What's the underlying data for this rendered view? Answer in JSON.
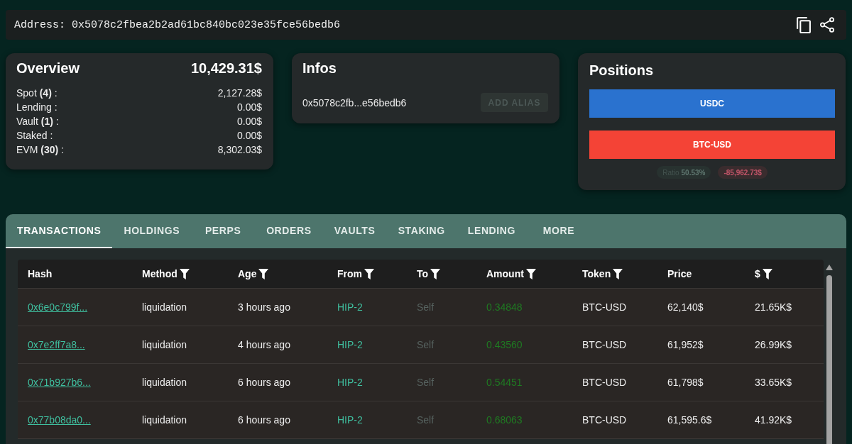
{
  "address_bar": {
    "label": "Address:",
    "value": "0x5078c2fbea2b2ad61bc840bc023e35fce56bedb6"
  },
  "overview": {
    "title": "Overview",
    "total": "10,429.31$",
    "rows": [
      {
        "label": "Spot **(4)** :",
        "value": "2,127.28$"
      },
      {
        "label": "Lending :",
        "value": "0.00$"
      },
      {
        "label": "Vault **(1)** :",
        "value": "0.00$"
      },
      {
        "label": "Staked :",
        "value": "0.00$"
      },
      {
        "label": "EVM **(30)** :",
        "value": "8,302.03$"
      }
    ]
  },
  "infos": {
    "title": "Infos",
    "address": "0x5078c2fb...e56bedb6",
    "alias_button": {
      "label": "ADD ALIAS",
      "disabled": true
    }
  },
  "positions": {
    "title": "Positions",
    "bars": [
      {
        "label": "USDC",
        "color": "#2a72cf"
      },
      {
        "label": "BTC-USD",
        "color": "#f44336"
      }
    ],
    "ratio": {
      "label": "Ratio",
      "value": "50.53%"
    },
    "pnl": "-85,962.73$"
  },
  "tabs": [
    {
      "label": "TRANSACTIONS",
      "selected": true
    },
    {
      "label": "HOLDINGS",
      "selected": false
    },
    {
      "label": "PERPS",
      "selected": false
    },
    {
      "label": "ORDERS",
      "selected": false
    },
    {
      "label": "VAULTS",
      "selected": false
    },
    {
      "label": "STAKING",
      "selected": false
    },
    {
      "label": "LENDING",
      "selected": false
    },
    {
      "label": "MORE",
      "selected": false
    }
  ],
  "table": {
    "columns": [
      {
        "label": "Hash",
        "filter": false
      },
      {
        "label": "Method",
        "filter": true
      },
      {
        "label": "Age",
        "filter": true
      },
      {
        "label": "From",
        "filter": true
      },
      {
        "label": "To",
        "filter": true
      },
      {
        "label": "Amount",
        "filter": true
      },
      {
        "label": "Token",
        "filter": true
      },
      {
        "label": "Price",
        "filter": false
      },
      {
        "label": "$",
        "filter": true
      }
    ],
    "rows": [
      {
        "hash": "0x6e0c799f...",
        "method": "liquidation",
        "age": "3 hours ago",
        "from": "HIP-2",
        "to": "Self",
        "amount": "0.34848",
        "token": "BTC-USD",
        "price": "62,140$",
        "value": "21.65K$"
      },
      {
        "hash": "0x7e2ff7a8...",
        "method": "liquidation",
        "age": "4 hours ago",
        "from": "HIP-2",
        "to": "Self",
        "amount": "0.43560",
        "token": "BTC-USD",
        "price": "61,952$",
        "value": "26.99K$"
      },
      {
        "hash": "0x71b927b6...",
        "method": "liquidation",
        "age": "6 hours ago",
        "from": "HIP-2",
        "to": "Self",
        "amount": "0.54451",
        "token": "BTC-USD",
        "price": "61,798$",
        "value": "33.65K$"
      },
      {
        "hash": "0x77b08da0...",
        "method": "liquidation",
        "age": "6 hours ago",
        "from": "HIP-2",
        "to": "Self",
        "amount": "0.68063",
        "token": "BTC-USD",
        "price": "61,595.6$",
        "value": "41.92K$"
      }
    ]
  }
}
